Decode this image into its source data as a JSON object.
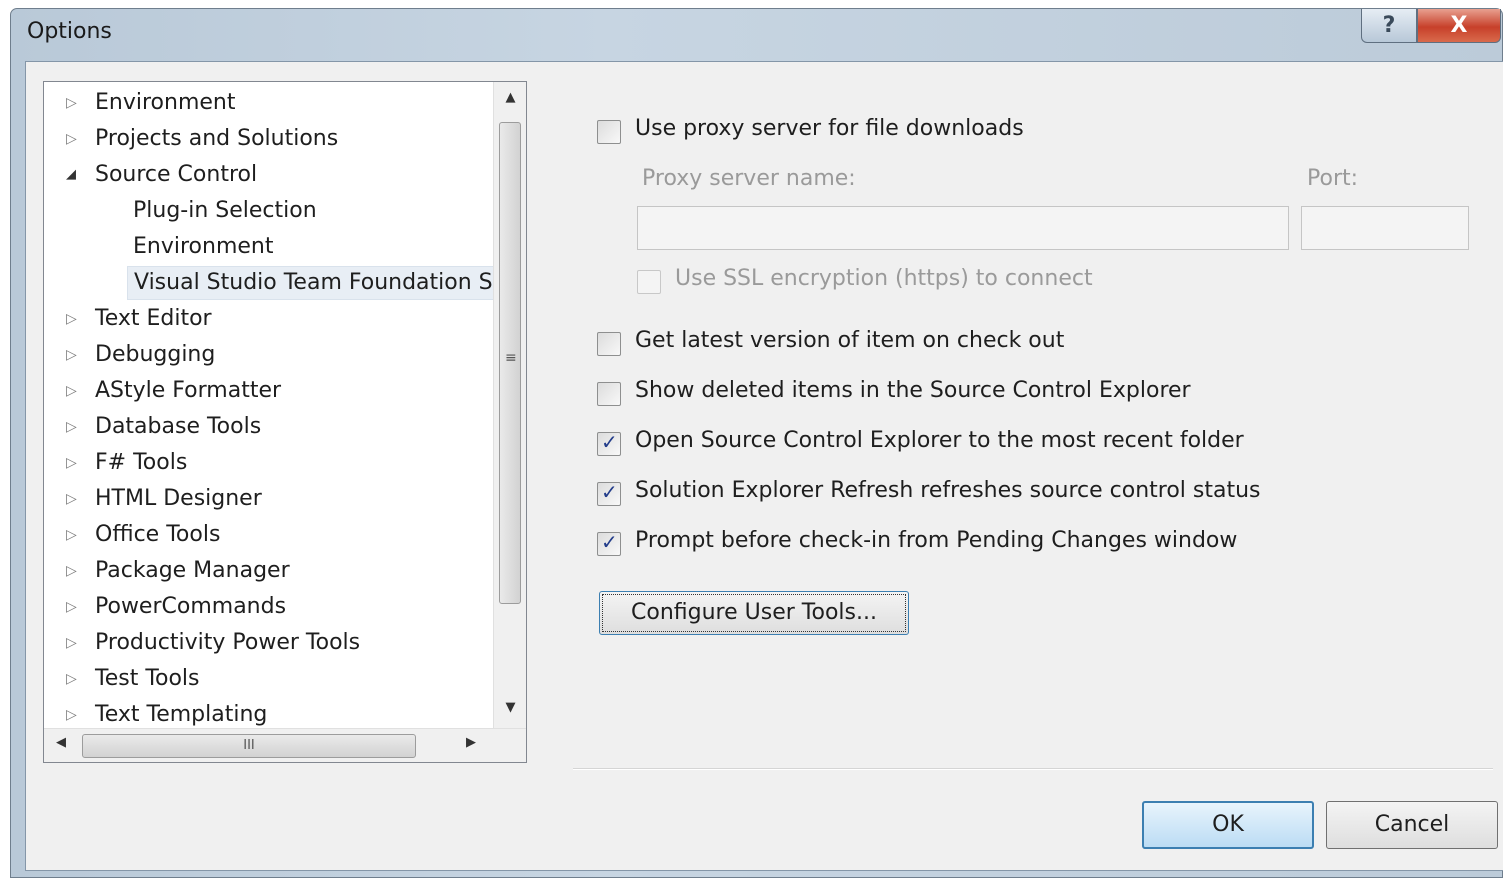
{
  "window": {
    "title": "Options",
    "help_glyph": "?",
    "close_glyph": "X"
  },
  "tree": {
    "items": [
      {
        "label": "Environment",
        "level": 0,
        "expanded": false
      },
      {
        "label": "Projects and Solutions",
        "level": 0,
        "expanded": false
      },
      {
        "label": "Source Control",
        "level": 0,
        "expanded": true
      },
      {
        "label": "Plug-in Selection",
        "level": 1
      },
      {
        "label": "Environment",
        "level": 1
      },
      {
        "label": "Visual Studio Team Foundation Se",
        "level": 1,
        "selected": true
      },
      {
        "label": "Text Editor",
        "level": 0,
        "expanded": false
      },
      {
        "label": "Debugging",
        "level": 0,
        "expanded": false
      },
      {
        "label": "AStyle Formatter",
        "level": 0,
        "expanded": false
      },
      {
        "label": "Database Tools",
        "level": 0,
        "expanded": false
      },
      {
        "label": "F# Tools",
        "level": 0,
        "expanded": false
      },
      {
        "label": "HTML Designer",
        "level": 0,
        "expanded": false
      },
      {
        "label": "Office Tools",
        "level": 0,
        "expanded": false
      },
      {
        "label": "Package Manager",
        "level": 0,
        "expanded": false
      },
      {
        "label": "PowerCommands",
        "level": 0,
        "expanded": false
      },
      {
        "label": "Productivity Power Tools",
        "level": 0,
        "expanded": false
      },
      {
        "label": "Test Tools",
        "level": 0,
        "expanded": false
      },
      {
        "label": "Text Templating",
        "level": 0,
        "expanded": false
      }
    ],
    "hscroll_grip": "III",
    "vscroll_grip": "≡"
  },
  "proxy": {
    "use_proxy_label": "Use proxy server for file downloads",
    "use_proxy_checked": false,
    "server_name_label": "Proxy server name:",
    "server_name_value": "",
    "port_label": "Port:",
    "port_value": "",
    "ssl_label": "Use SSL encryption (https) to connect",
    "ssl_checked": false
  },
  "options": [
    {
      "label": "Get latest version of item on check out",
      "checked": false
    },
    {
      "label": "Show deleted items in the Source Control Explorer",
      "checked": false
    },
    {
      "label": "Open Source Control Explorer to the most recent folder",
      "checked": true
    },
    {
      "label": "Solution Explorer Refresh refreshes source control status",
      "checked": true
    },
    {
      "label": "Prompt before check-in from Pending Changes window",
      "checked": true
    }
  ],
  "buttons": {
    "configure": "Configure User Tools...",
    "ok": "OK",
    "cancel": "Cancel"
  }
}
